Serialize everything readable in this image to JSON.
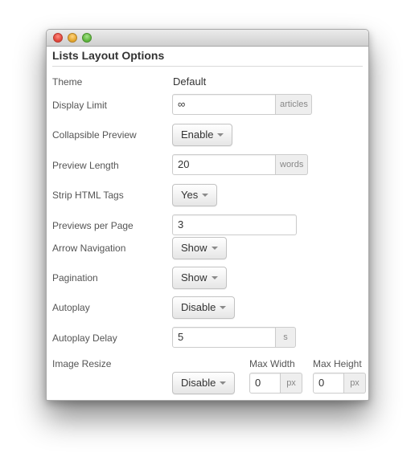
{
  "panel": {
    "title": "Lists Layout Options"
  },
  "rows": {
    "theme": {
      "label": "Theme",
      "value": "Default"
    },
    "display_limit": {
      "label": "Display Limit",
      "value": "∞",
      "unit": "articles"
    },
    "collapsible_preview": {
      "label": "Collapsible Preview",
      "selected": "Enable"
    },
    "preview_length": {
      "label": "Preview Length",
      "value": "20",
      "unit": "words"
    },
    "strip_html": {
      "label": "Strip HTML Tags",
      "selected": "Yes"
    },
    "previews_per_page": {
      "label": "Previews per Page",
      "value": "3"
    },
    "arrow_navigation": {
      "label": "Arrow Navigation",
      "selected": "Show"
    },
    "pagination": {
      "label": "Pagination",
      "selected": "Show"
    },
    "autoplay": {
      "label": "Autoplay",
      "selected": "Disable"
    },
    "autoplay_delay": {
      "label": "Autoplay Delay",
      "value": "5",
      "unit": "s"
    },
    "image_resize": {
      "label": "Image Resize",
      "selected": "Disable",
      "max_width": {
        "label": "Max Width",
        "value": "0",
        "unit": "px"
      },
      "max_height": {
        "label": "Max Height",
        "value": "0",
        "unit": "px"
      }
    }
  },
  "colors": {
    "label_text": "#555555",
    "value_text": "#333333",
    "addon_bg": "#eeeeee",
    "border": "#cccccc"
  },
  "icons": [
    "close-icon",
    "minimize-icon",
    "maximize-icon",
    "caret-down-icon"
  ]
}
